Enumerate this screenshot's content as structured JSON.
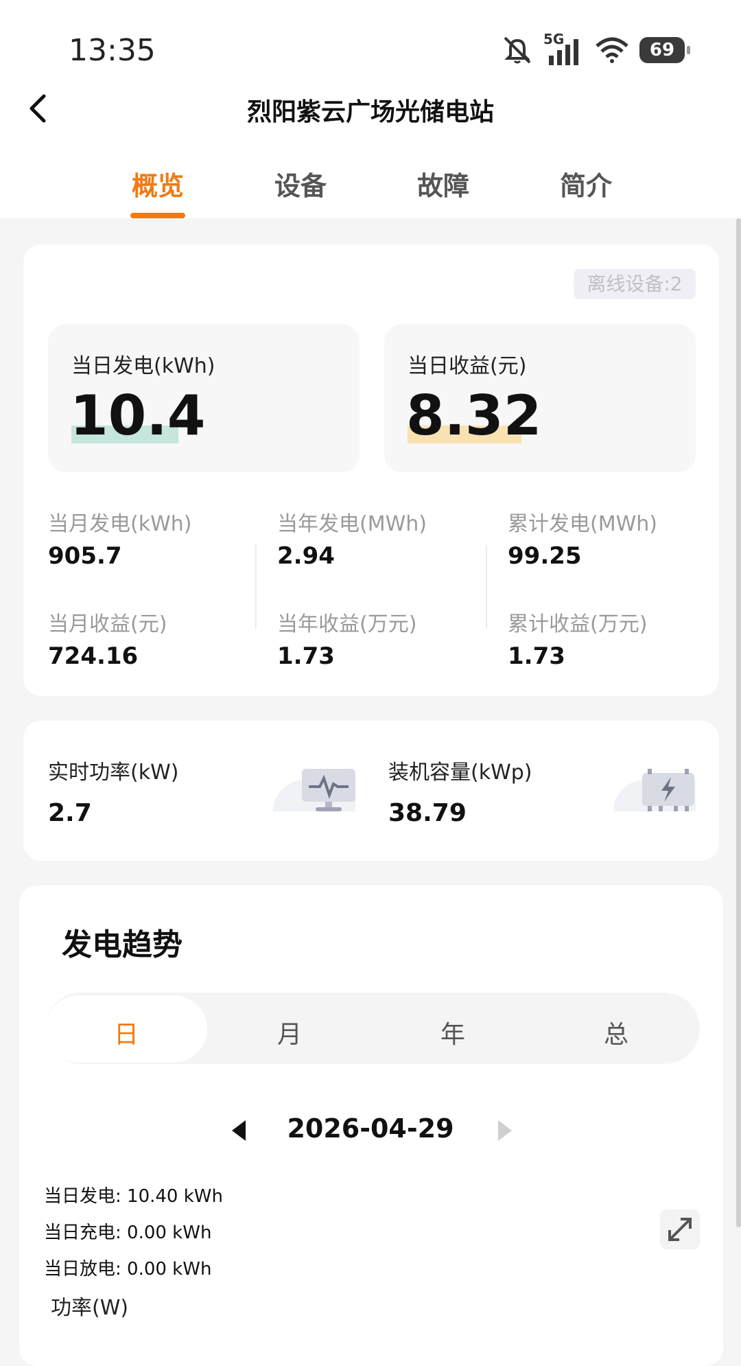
{
  "status_bar": {
    "time": "13:35",
    "network": "5G",
    "battery": "69"
  },
  "header": {
    "title": "烈阳紫云广场光储电站"
  },
  "tabs": [
    {
      "label": "概览",
      "active": true
    },
    {
      "label": "设备",
      "active": false
    },
    {
      "label": "故障",
      "active": false
    },
    {
      "label": "简介",
      "active": false
    }
  ],
  "overview": {
    "offline_badge": "离线设备:2",
    "daily_generation": {
      "label": "当日发电(kWh)",
      "value": "10.4"
    },
    "daily_income": {
      "label": "当日收益(元)",
      "value": "8.32"
    },
    "stats": [
      {
        "label": "当月发电(kWh)",
        "value": "905.7"
      },
      {
        "label": "当年发电(MWh)",
        "value": "2.94"
      },
      {
        "label": "累计发电(MWh)",
        "value": "99.25"
      },
      {
        "label": "当月收益(元)",
        "value": "724.16"
      },
      {
        "label": "当年收益(万元)",
        "value": "1.73"
      },
      {
        "label": "累计收益(万元)",
        "value": "1.73"
      }
    ]
  },
  "power": {
    "realtime": {
      "label": "实时功率(kW)",
      "value": "2.7"
    },
    "capacity": {
      "label": "装机容量(kWp)",
      "value": "38.79"
    }
  },
  "trend": {
    "title": "发电趋势",
    "periods": [
      "日",
      "月",
      "年",
      "总"
    ],
    "active_period": "日",
    "date": "2026-04-29",
    "daily_generation": "当日发电: 10.40 kWh",
    "daily_charge": "当日充电: 0.00 kWh",
    "daily_discharge": "当日放电: 0.00 kWh",
    "y_axis_label": "功率(W)"
  },
  "colors": {
    "accent": "#f07a14",
    "generation_highlight": "#c6e5dc",
    "income_highlight": "#f8e2b2"
  }
}
